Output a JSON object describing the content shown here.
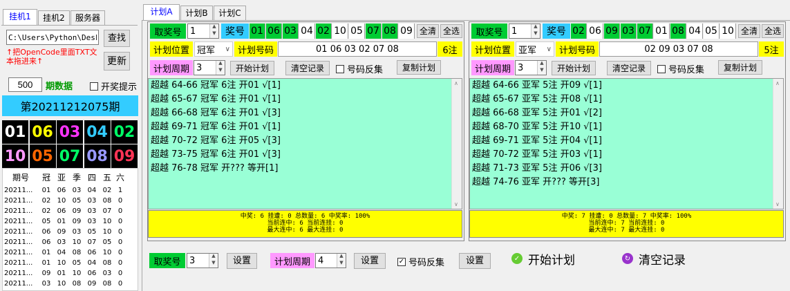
{
  "left": {
    "tabs": [
      "挂机1",
      "挂机2",
      "服务器"
    ],
    "path_value": "C:\\Users\\Python\\Deskto",
    "find_button": "查找",
    "refresh_button": "更新",
    "hint": "↑把OpenCode里面TXT文本拖进来↑",
    "period_count": "500",
    "period_label": "期数据",
    "open_prize_tip": "开奖提示",
    "issue": "第20211212075期",
    "balls": [
      {
        "n": "01",
        "c": "#ffffff"
      },
      {
        "n": "06",
        "c": "#ffff00"
      },
      {
        "n": "03",
        "c": "#ff33ff"
      },
      {
        "n": "04",
        "c": "#33ccff"
      },
      {
        "n": "02",
        "c": "#00ff66"
      },
      {
        "n": "10",
        "c": "#ff99ff"
      },
      {
        "n": "05",
        "c": "#ff6600"
      },
      {
        "n": "07",
        "c": "#00ff66"
      },
      {
        "n": "08",
        "c": "#9999ff"
      },
      {
        "n": "09",
        "c": "#ff3355"
      }
    ],
    "history_headers": [
      "期号",
      "冠",
      "亚",
      "季",
      "四",
      "五",
      "六"
    ],
    "history_rows": [
      [
        "20211...",
        "01",
        "06",
        "03",
        "04",
        "02",
        "1"
      ],
      [
        "20211...",
        "02",
        "10",
        "05",
        "03",
        "08",
        "0"
      ],
      [
        "20211...",
        "02",
        "06",
        "09",
        "03",
        "07",
        "0"
      ],
      [
        "20211...",
        "05",
        "01",
        "09",
        "03",
        "10",
        "0"
      ],
      [
        "20211...",
        "06",
        "09",
        "03",
        "05",
        "10",
        "0"
      ],
      [
        "20211...",
        "06",
        "03",
        "10",
        "07",
        "05",
        "0"
      ],
      [
        "20211...",
        "01",
        "04",
        "08",
        "06",
        "10",
        "0"
      ],
      [
        "20211...",
        "01",
        "10",
        "05",
        "04",
        "08",
        "0"
      ],
      [
        "20211...",
        "09",
        "01",
        "10",
        "06",
        "03",
        "0"
      ],
      [
        "20211...",
        "03",
        "10",
        "08",
        "09",
        "08",
        "0"
      ]
    ]
  },
  "plan_tabs": [
    "计划A",
    "计划B",
    "计划C"
  ],
  "plans": [
    {
      "pick_label": "取奖号",
      "pick_value": "1",
      "award_label": "奖号",
      "award_numbers": [
        {
          "n": "01",
          "hl": true
        },
        {
          "n": "06",
          "hl": true
        },
        {
          "n": "03",
          "hl": true
        },
        {
          "n": "04",
          "hl": false
        },
        {
          "n": "02",
          "hl": true
        },
        {
          "n": "10",
          "hl": false
        },
        {
          "n": "05",
          "hl": false
        },
        {
          "n": "07",
          "hl": true
        },
        {
          "n": "08",
          "hl": true
        },
        {
          "n": "09",
          "hl": false
        }
      ],
      "clear_all": "全清",
      "select_all": "全选",
      "position_label": "计划位置",
      "position_value": "冠军",
      "code_label": "计划号码",
      "code_value": "01 06 03 02 07 08",
      "count_badge": "6注",
      "cycle_label": "计划周期",
      "cycle_value": "3",
      "start_button": "开始计划",
      "clear_record_button": "清空记录",
      "reverse_label": "号码反集",
      "copy_button": "复制计划",
      "log": [
        "超越 64-66 冠军 6注 开01 √[1]",
        "超越 65-67 冠军 6注 开01 √[1]",
        "超越 66-68 冠军 6注 开01 √[3]",
        "超越 69-71 冠军 6注 开01 √[1]",
        "超越 70-72 冠军 6注 开05 √[3]",
        "超越 73-75 冠军 6注 开01 √[3]",
        "超越 76-78 冠军 开???  等开[1]"
      ],
      "stats": [
        "中奖: 6  挂遭: 0  总数量: 6   中奖率: 100%",
        "当前连中: 6  当前连挂: 0",
        "最大连中: 6  最大连挂: 0"
      ]
    },
    {
      "pick_label": "取奖号",
      "pick_value": "1",
      "award_label": "奖号",
      "award_numbers": [
        {
          "n": "02",
          "hl": true
        },
        {
          "n": "06",
          "hl": false
        },
        {
          "n": "09",
          "hl": true
        },
        {
          "n": "03",
          "hl": true
        },
        {
          "n": "07",
          "hl": true
        },
        {
          "n": "01",
          "hl": false
        },
        {
          "n": "08",
          "hl": true
        },
        {
          "n": "04",
          "hl": false
        },
        {
          "n": "05",
          "hl": false
        },
        {
          "n": "10",
          "hl": false
        }
      ],
      "clear_all": "全清",
      "select_all": "全选",
      "position_label": "计划位置",
      "position_value": "亚军",
      "code_label": "计划号码",
      "code_value": "02 09 03 07 08",
      "count_badge": "5注",
      "cycle_label": "计划周期",
      "cycle_value": "3",
      "start_button": "开始计划",
      "clear_record_button": "清空记录",
      "reverse_label": "号码反集",
      "copy_button": "复制计划",
      "log": [
        "超越 64-66 亚军 5注 开09 √[1]",
        "超越 65-67 亚军 5注 开08 √[1]",
        "超越 66-68 亚军 5注 开01 √[2]",
        "超越 68-70 亚军 5注 开10 √[1]",
        "超越 69-71 亚军 5注 开04 √[1]",
        "超越 70-72 亚军 5注 开03 √[1]",
        "超越 71-73 亚军 5注 开06 √[3]",
        "超越 74-76 亚军 开???  等开[3]"
      ],
      "stats": [
        "中奖: 7  挂遭: 0  总数量: 7   中奖率: 100%",
        "当前连中: 7  当前连挂: 0",
        "最大连中: 7  最大连挂: 0"
      ]
    }
  ],
  "bottom": {
    "pick_label": "取奖号",
    "pick_value": "3",
    "set1": "设置",
    "cycle_label": "计划周期",
    "cycle_value": "4",
    "set2": "设置",
    "reverse_label": "号码反集",
    "set3": "设置",
    "start_plan": "开始计划",
    "clear_record": "清空记录",
    "check_mark": "✓"
  }
}
